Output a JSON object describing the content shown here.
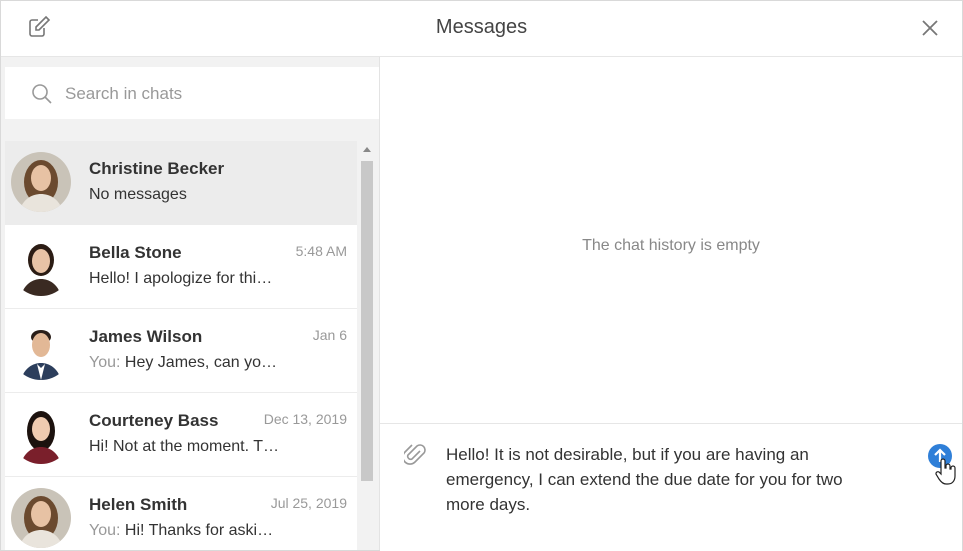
{
  "header": {
    "title": "Messages",
    "compose_icon": "compose-icon",
    "close_icon": "close-icon"
  },
  "search": {
    "placeholder": "Search in chats",
    "value": ""
  },
  "chats": [
    {
      "name": "Christine Becker",
      "time": "",
      "you": "",
      "preview": "No messages"
    },
    {
      "name": "Bella Stone",
      "time": "5:48 AM",
      "you": "",
      "preview": "Hello! I apologize for thi…"
    },
    {
      "name": "James Wilson",
      "time": "Jan 6",
      "you": "You:",
      "preview": "Hey James, can yo…"
    },
    {
      "name": "Courteney Bass",
      "time": "Dec 13, 2019",
      "you": "",
      "preview": "Hi! Not at the moment. T…"
    },
    {
      "name": "Helen Smith",
      "time": "Jul 25, 2019",
      "you": "You:",
      "preview": "Hi! Thanks for aski…"
    }
  ],
  "chat": {
    "empty_text": "The chat history is empty",
    "draft": "Hello! It is not desirable, but if you are having an emergency,  I can extend the due date for you for two more days."
  },
  "colors": {
    "accent": "#2f7fd8",
    "active_row": "#ececec"
  }
}
